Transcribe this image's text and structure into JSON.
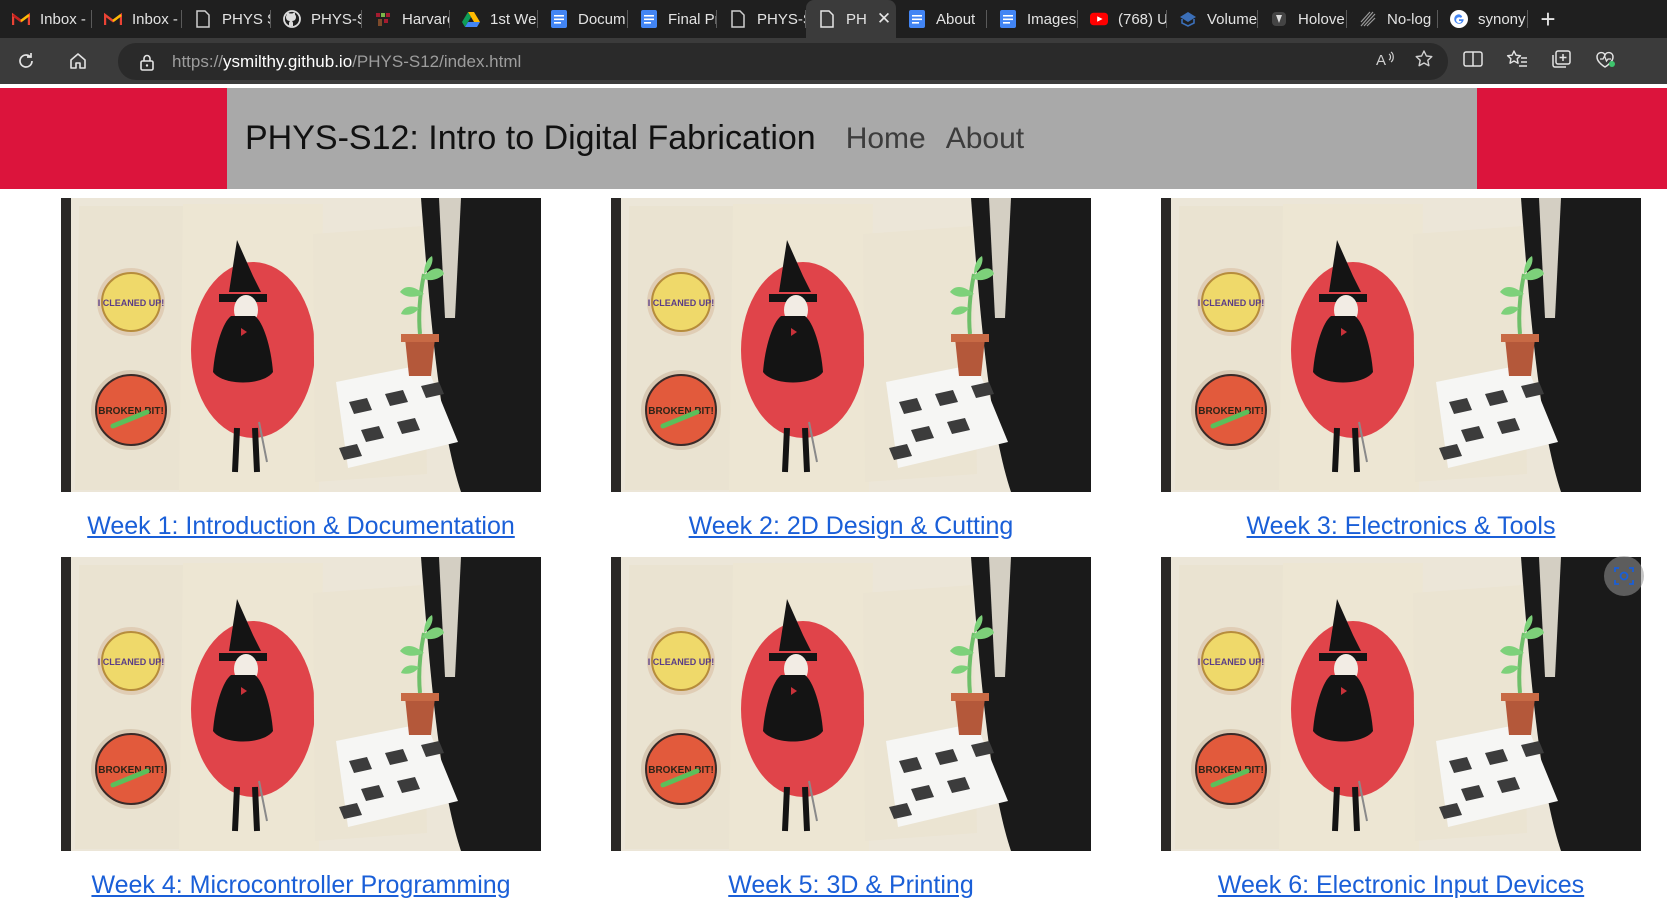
{
  "browser": {
    "tabs": [
      {
        "title": "Inbox -",
        "icon": "gmail-icon"
      },
      {
        "title": "Inbox -",
        "icon": "gmail-icon"
      },
      {
        "title": "PHYS S",
        "icon": "page-icon"
      },
      {
        "title": "PHYS-S",
        "icon": "github-icon"
      },
      {
        "title": "Harvarc",
        "icon": "harvard-icon"
      },
      {
        "title": "1st We",
        "icon": "google-drive-icon"
      },
      {
        "title": "Docum",
        "icon": "google-docs-icon"
      },
      {
        "title": "Final Pr",
        "icon": "google-docs-icon"
      },
      {
        "title": "PHYS-S",
        "icon": "page-icon"
      },
      {
        "title": "PH",
        "icon": "page-icon",
        "active": true
      },
      {
        "title": "About",
        "icon": "google-docs-icon"
      },
      {
        "title": "Images",
        "icon": "google-docs-icon"
      },
      {
        "title": "(768) U",
        "icon": "youtube-icon"
      },
      {
        "title": "Volume",
        "icon": "volume-icon"
      },
      {
        "title": "Holove",
        "icon": "holove-icon"
      },
      {
        "title": "No-log",
        "icon": "nolog-icon"
      },
      {
        "title": "synony",
        "icon": "google-icon"
      }
    ],
    "new_tab_label": "+",
    "close_tab_label": "✕",
    "url_prefix": "https://",
    "url_host": "ysmilthy.github.io",
    "url_path": "/PHYS-S12/index.html"
  },
  "site": {
    "title": "PHYS-S12: Intro to Digital Fabrication",
    "nav": [
      {
        "label": "Home"
      },
      {
        "label": "About"
      }
    ],
    "colors": {
      "banner": "#dc143c",
      "header_bg": "#a9a9a9",
      "link": "#1a5fd8"
    }
  },
  "weeks": [
    {
      "label": "Week 1: Introduction & Documentation"
    },
    {
      "label": "Week 2: 2D Design & Cutting"
    },
    {
      "label": "Week 3: Electronics & Tools"
    },
    {
      "label": "Week 4: Microcontroller Programming"
    },
    {
      "label": "Week 5: 3D & Printing"
    },
    {
      "label": "Week 6: Electronic Input Devices"
    }
  ],
  "thumbnail": {
    "patch_top_text": "I CLEANED UP!",
    "patch_bottom_text": "BROKEN BIT!"
  }
}
